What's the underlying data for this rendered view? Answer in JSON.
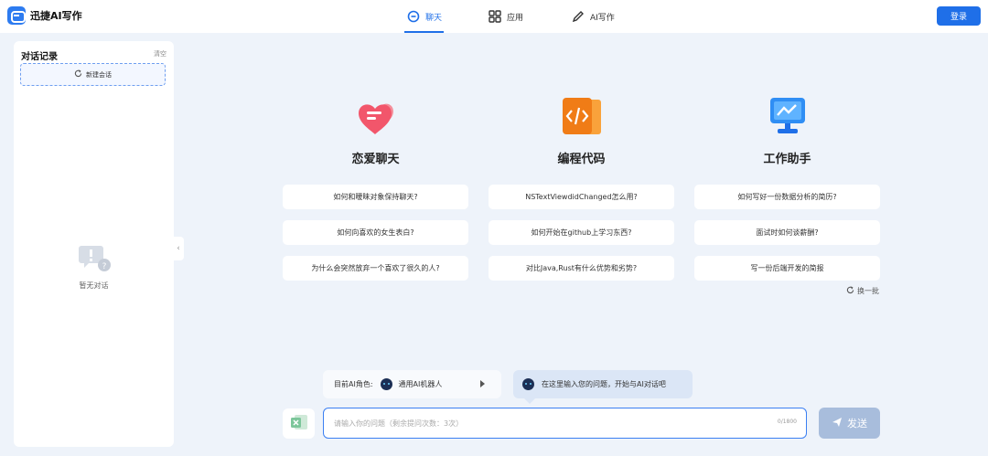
{
  "header": {
    "logo_text": "迅捷AI写作",
    "tabs": [
      {
        "label": "聊天",
        "icon": "chat-icon",
        "active": true
      },
      {
        "label": "应用",
        "icon": "apps-grid-icon",
        "active": false
      },
      {
        "label": "AI写作",
        "icon": "pen-icon",
        "active": false
      }
    ],
    "login_label": "登录"
  },
  "sidebar": {
    "title": "对话记录",
    "clear_label": "清空",
    "new_chat_label": "新建会话",
    "empty_text": "暂无对话"
  },
  "categories": [
    {
      "title": "恋爱聊天",
      "icon": "heart-chat-icon",
      "questions": [
        "如何和暧昧对象保持聊天?",
        "如何向喜欢的女生表白?",
        "为什么会突然放弃一个喜欢了很久的人?"
      ]
    },
    {
      "title": "编程代码",
      "icon": "code-icon",
      "questions": [
        "NSTextViewdidChanged怎么用?",
        "如何开始在github上学习东西?",
        "对比Java,Rust有什么优势和劣势?"
      ]
    },
    {
      "title": "工作助手",
      "icon": "monitor-chart-icon",
      "questions": [
        "如何写好一份数据分析的简历?",
        "面试时如何谈薪酬?",
        "写一份后端开发的简报"
      ]
    }
  ],
  "refresh_label": "换一批",
  "role": {
    "label": "目前AI角色:",
    "name": "通用AI机器人"
  },
  "hint_text": "在这里输入您的问题，开始与AI对话吧",
  "input": {
    "placeholder": "请输入你的问题（剩余提问次数：3次）",
    "counter": "0/1800"
  },
  "send_label": "发送",
  "colors": {
    "accent": "#1f6fe8",
    "send_disabled": "#a8bddc",
    "background": "#eef3fa"
  }
}
